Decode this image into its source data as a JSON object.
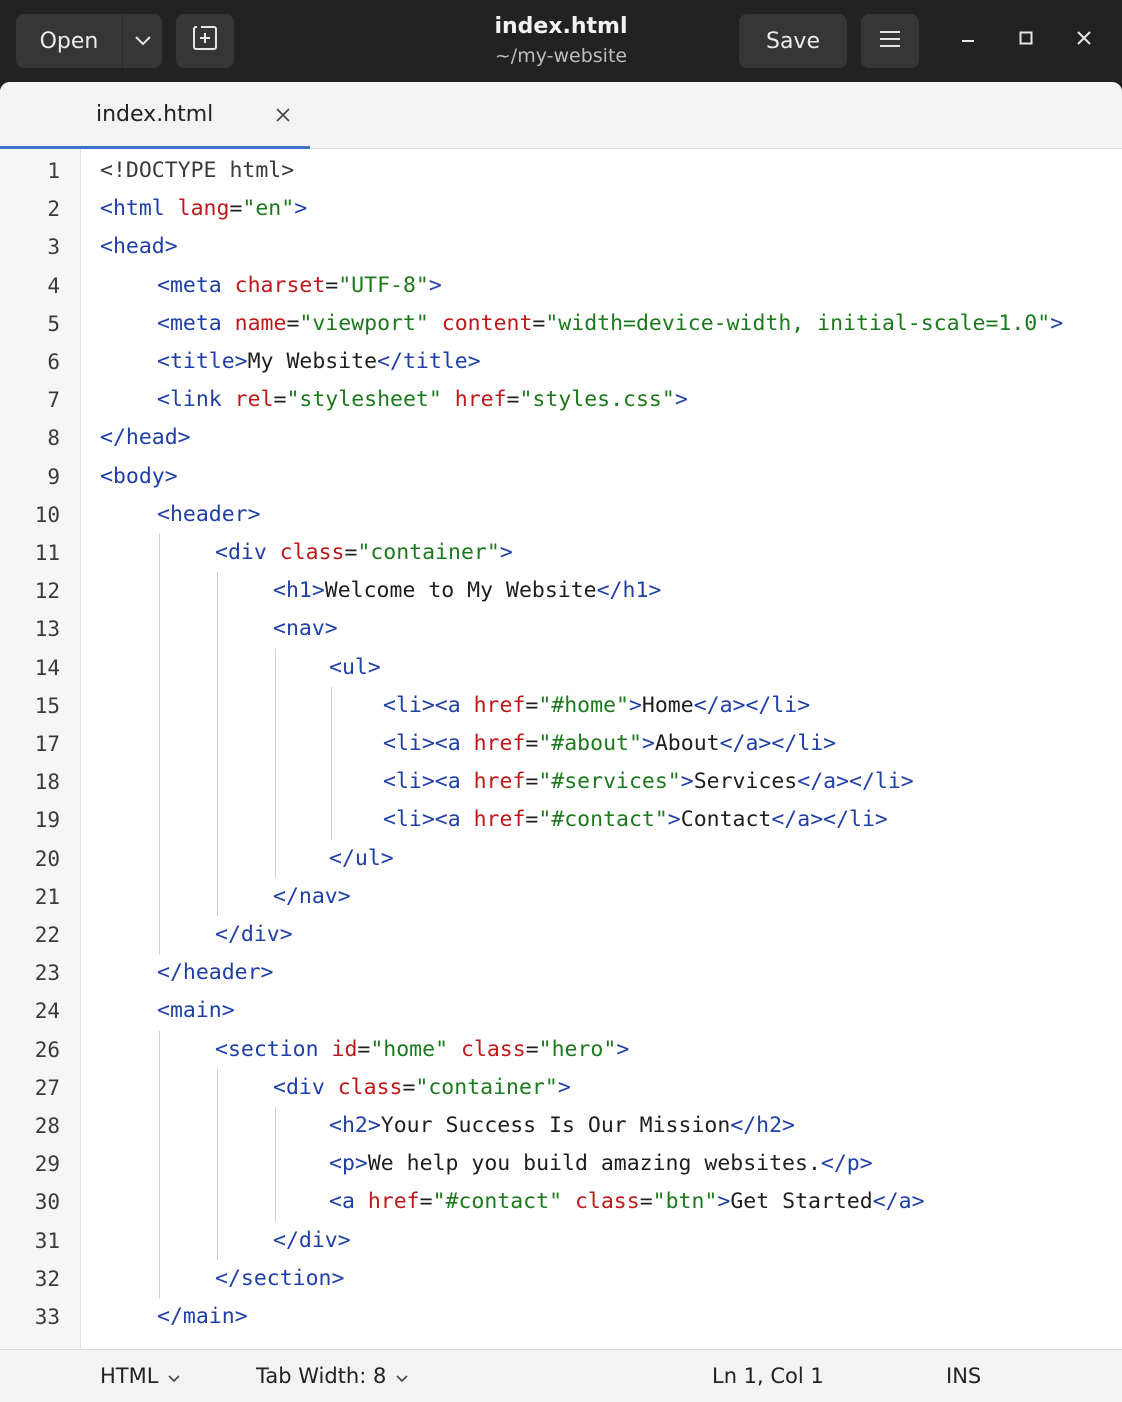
{
  "header": {
    "open_label": "Open",
    "save_label": "Save",
    "title": "index.html",
    "subtitle": "~/my-website"
  },
  "tab": {
    "label": "index.html"
  },
  "editor": {
    "lines": [
      {
        "n": "1",
        "indent": 0,
        "tokens": [
          [
            "dt",
            "<!DOCTYPE html>"
          ]
        ]
      },
      {
        "n": "2",
        "indent": 0,
        "tokens": [
          [
            "tg",
            "<html "
          ],
          [
            "at",
            "lang"
          ],
          [
            "pl",
            "="
          ],
          [
            "vl",
            "\"en\""
          ],
          [
            "tg",
            ">"
          ]
        ]
      },
      {
        "n": "3",
        "indent": 0,
        "tokens": [
          [
            "tg",
            "<head>"
          ]
        ]
      },
      {
        "n": "4",
        "indent": 1,
        "tokens": [
          [
            "tg",
            "<meta "
          ],
          [
            "at",
            "charset"
          ],
          [
            "pl",
            "="
          ],
          [
            "vl",
            "\"UTF-8\""
          ],
          [
            "tg",
            ">"
          ]
        ]
      },
      {
        "n": "5",
        "indent": 1,
        "tokens": [
          [
            "tg",
            "<meta "
          ],
          [
            "at",
            "name"
          ],
          [
            "pl",
            "="
          ],
          [
            "vl",
            "\"viewport\" "
          ],
          [
            "at",
            "content"
          ],
          [
            "pl",
            "="
          ],
          [
            "vl",
            "\"width=device-width, initial-scale=1.0\""
          ],
          [
            "tg",
            ">"
          ]
        ]
      },
      {
        "n": "6",
        "indent": 1,
        "tokens": [
          [
            "tg",
            "<title>"
          ],
          [
            "pl",
            "My Website"
          ],
          [
            "tg",
            "</title>"
          ]
        ]
      },
      {
        "n": "7",
        "indent": 1,
        "tokens": [
          [
            "tg",
            "<link "
          ],
          [
            "at",
            "rel"
          ],
          [
            "pl",
            "="
          ],
          [
            "vl",
            "\"stylesheet\" "
          ],
          [
            "at",
            "href"
          ],
          [
            "pl",
            "="
          ],
          [
            "vl",
            "\"styles.css\""
          ],
          [
            "tg",
            ">"
          ]
        ]
      },
      {
        "n": "8",
        "indent": 0,
        "tokens": [
          [
            "tg",
            "</head>"
          ]
        ]
      },
      {
        "n": "9",
        "indent": 0,
        "tokens": [
          [
            "tg",
            "<body>"
          ]
        ]
      },
      {
        "n": "10",
        "indent": 1,
        "tokens": [
          [
            "tg",
            "<header>"
          ]
        ]
      },
      {
        "n": "11",
        "indent": 2,
        "tokens": [
          [
            "tg",
            "<div "
          ],
          [
            "at",
            "class"
          ],
          [
            "pl",
            "="
          ],
          [
            "vl",
            "\"container\""
          ],
          [
            "tg",
            ">"
          ]
        ]
      },
      {
        "n": "12",
        "indent": 3,
        "tokens": [
          [
            "tg",
            "<h1>"
          ],
          [
            "pl",
            "Welcome to My Website"
          ],
          [
            "tg",
            "</h1>"
          ]
        ]
      },
      {
        "n": "13",
        "indent": 3,
        "tokens": [
          [
            "tg",
            "<nav>"
          ]
        ]
      },
      {
        "n": "14",
        "indent": 4,
        "tokens": [
          [
            "tg",
            "<ul>"
          ]
        ]
      },
      {
        "n": "15",
        "indent": 5,
        "tokens": [
          [
            "tg",
            "<li><a "
          ],
          [
            "at",
            "href"
          ],
          [
            "pl",
            "="
          ],
          [
            "vl",
            "\"#home\""
          ],
          [
            "tg",
            ">"
          ],
          [
            "pl",
            "Home"
          ],
          [
            "tg",
            "</a></li>"
          ]
        ]
      },
      {
        "n": "17",
        "indent": 5,
        "tokens": [
          [
            "tg",
            "<li><a "
          ],
          [
            "at",
            "href"
          ],
          [
            "pl",
            "="
          ],
          [
            "vl",
            "\"#about\""
          ],
          [
            "tg",
            ">"
          ],
          [
            "pl",
            "About"
          ],
          [
            "tg",
            "</a></li>"
          ]
        ]
      },
      {
        "n": "18",
        "indent": 5,
        "tokens": [
          [
            "tg",
            "<li><a "
          ],
          [
            "at",
            "href"
          ],
          [
            "pl",
            "="
          ],
          [
            "vl",
            "\"#services\""
          ],
          [
            "tg",
            ">"
          ],
          [
            "pl",
            "Services"
          ],
          [
            "tg",
            "</a></li>"
          ]
        ]
      },
      {
        "n": "19",
        "indent": 5,
        "tokens": [
          [
            "tg",
            "<li><a "
          ],
          [
            "at",
            "href"
          ],
          [
            "pl",
            "="
          ],
          [
            "vl",
            "\"#contact\""
          ],
          [
            "tg",
            ">"
          ],
          [
            "pl",
            "Contact"
          ],
          [
            "tg",
            "</a></li>"
          ]
        ]
      },
      {
        "n": "20",
        "indent": 4,
        "tokens": [
          [
            "tg",
            "</ul>"
          ]
        ]
      },
      {
        "n": "21",
        "indent": 3,
        "tokens": [
          [
            "tg",
            "</nav>"
          ]
        ]
      },
      {
        "n": "22",
        "indent": 2,
        "tokens": [
          [
            "tg",
            "</div>"
          ]
        ]
      },
      {
        "n": "23",
        "indent": 1,
        "tokens": [
          [
            "tg",
            "</header>"
          ]
        ]
      },
      {
        "n": "24",
        "indent": 1,
        "tokens": [
          [
            "tg",
            "<main>"
          ]
        ]
      },
      {
        "n": "26",
        "indent": 2,
        "tokens": [
          [
            "tg",
            "<section "
          ],
          [
            "at",
            "id"
          ],
          [
            "pl",
            "="
          ],
          [
            "vl",
            "\"home\" "
          ],
          [
            "at",
            "class"
          ],
          [
            "pl",
            "="
          ],
          [
            "vl",
            "\"hero\""
          ],
          [
            "tg",
            ">"
          ]
        ]
      },
      {
        "n": "27",
        "indent": 3,
        "tokens": [
          [
            "tg",
            "<div "
          ],
          [
            "at",
            "class"
          ],
          [
            "pl",
            "="
          ],
          [
            "vl",
            "\"container\""
          ],
          [
            "tg",
            ">"
          ]
        ]
      },
      {
        "n": "28",
        "indent": 4,
        "tokens": [
          [
            "tg",
            "<h2>"
          ],
          [
            "pl",
            "Your Success Is Our Mission"
          ],
          [
            "tg",
            "</h2>"
          ]
        ]
      },
      {
        "n": "29",
        "indent": 4,
        "tokens": [
          [
            "tg",
            "<p>"
          ],
          [
            "pl",
            "We help you build amazing websites."
          ],
          [
            "tg",
            "</p>"
          ]
        ]
      },
      {
        "n": "30",
        "indent": 4,
        "tokens": [
          [
            "tg",
            "<a "
          ],
          [
            "at",
            "href"
          ],
          [
            "pl",
            "="
          ],
          [
            "vl",
            "\"#contact\" "
          ],
          [
            "at",
            "class"
          ],
          [
            "pl",
            "="
          ],
          [
            "vl",
            "\"btn\""
          ],
          [
            "tg",
            ">"
          ],
          [
            "pl",
            "Get Started"
          ],
          [
            "tg",
            "</a>"
          ]
        ]
      },
      {
        "n": "31",
        "indent": 3,
        "tokens": [
          [
            "tg",
            "</div>"
          ]
        ]
      },
      {
        "n": "32",
        "indent": 2,
        "tokens": [
          [
            "tg",
            "</section>"
          ]
        ]
      },
      {
        "n": "33",
        "indent": 1,
        "tokens": [
          [
            "tg",
            "</main>"
          ]
        ]
      }
    ]
  },
  "status": {
    "language": "HTML",
    "tab_width": "Tab Width:  8",
    "position": "Ln 1, Col 1",
    "mode": "INS"
  },
  "colors": {
    "tag": "#1f3fa8",
    "attribute": "#c01818",
    "value": "#1b7a1b",
    "accent": "#3f74c9"
  }
}
